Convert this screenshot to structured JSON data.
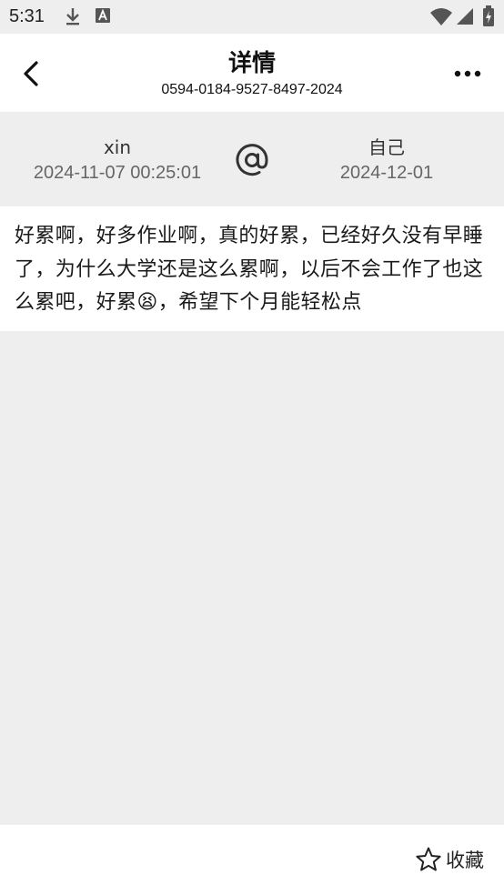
{
  "status_bar": {
    "time": "5:31",
    "left_icons": [
      "download-icon",
      "keyboard-a-icon"
    ],
    "right_icons": [
      "wifi-icon",
      "signal-icon",
      "battery-icon"
    ]
  },
  "header": {
    "title": "详情",
    "subtitle": "0594-0184-9527-8497-2024",
    "back_icon": "back-arrow-icon",
    "more_icon": "more-dots-icon"
  },
  "info": {
    "sender": {
      "name": "xin",
      "date": "2024-11-07 00:25:01"
    },
    "connector_icon": "at-sign-icon",
    "recipient": {
      "name": "自己",
      "date": "2024-12-01"
    }
  },
  "content": {
    "text": "好累啊，好多作业啊，真的好累，已经好久没有早睡了，为什么大学还是这么累啊，以后不会工作了也这么累吧，好累😫，希望下个月能轻松点"
  },
  "bottom_bar": {
    "favorite_label": "收藏",
    "favorite_icon": "star-outline-icon"
  },
  "colors": {
    "background": "#eeeeee",
    "card": "#ffffff",
    "text_primary": "#1a1a1a",
    "text_secondary": "#666666"
  }
}
